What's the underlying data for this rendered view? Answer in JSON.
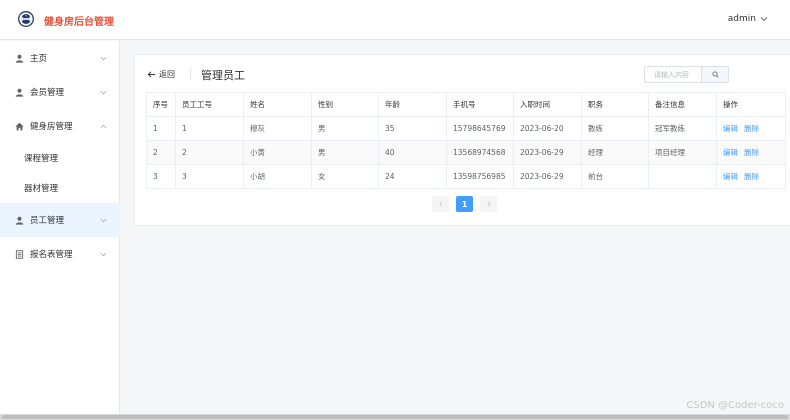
{
  "header": {
    "app_title": "健身房后台管理",
    "user": "admin"
  },
  "sidebar": {
    "items": [
      {
        "label": "主页",
        "icon": "user-icon",
        "expanded": false
      },
      {
        "label": "会员管理",
        "icon": "user-icon",
        "expanded": false
      },
      {
        "label": "健身房管理",
        "icon": "home-icon",
        "expanded": true
      },
      {
        "label": "课程管理",
        "sub": true
      },
      {
        "label": "器材管理",
        "sub": true
      },
      {
        "label": "员工管理",
        "icon": "user-icon",
        "expanded": false,
        "active": true
      },
      {
        "label": "报名表管理",
        "icon": "document-icon",
        "expanded": false
      }
    ]
  },
  "main": {
    "back_label": "返回",
    "title": "管理员工",
    "search": {
      "placeholder": "请输入内容",
      "value": ""
    },
    "table": {
      "headers": [
        "序号",
        "员工工号",
        "姓名",
        "性别",
        "年龄",
        "手机号",
        "入职时间",
        "职务",
        "备注信息",
        "操作"
      ],
      "rows": [
        [
          "1",
          "1",
          "穆灰",
          "男",
          "35",
          "15798645769",
          "2023-06-20",
          "教练",
          "冠军教练"
        ],
        [
          "2",
          "2",
          "小黄",
          "男",
          "40",
          "13568974568",
          "2023-06-29",
          "经理",
          "项目经理"
        ],
        [
          "3",
          "3",
          "小胡",
          "女",
          "24",
          "13598756985",
          "2023-06-29",
          "前台",
          ""
        ]
      ],
      "actions": {
        "edit": "编辑",
        "delete": "删除"
      }
    },
    "pagination": {
      "current": "1"
    }
  },
  "watermark": "CSDN @Coder-coco",
  "colors": {
    "brand": "#e6553a",
    "accent": "#409eff",
    "active_bg": "#ecf5ff"
  }
}
